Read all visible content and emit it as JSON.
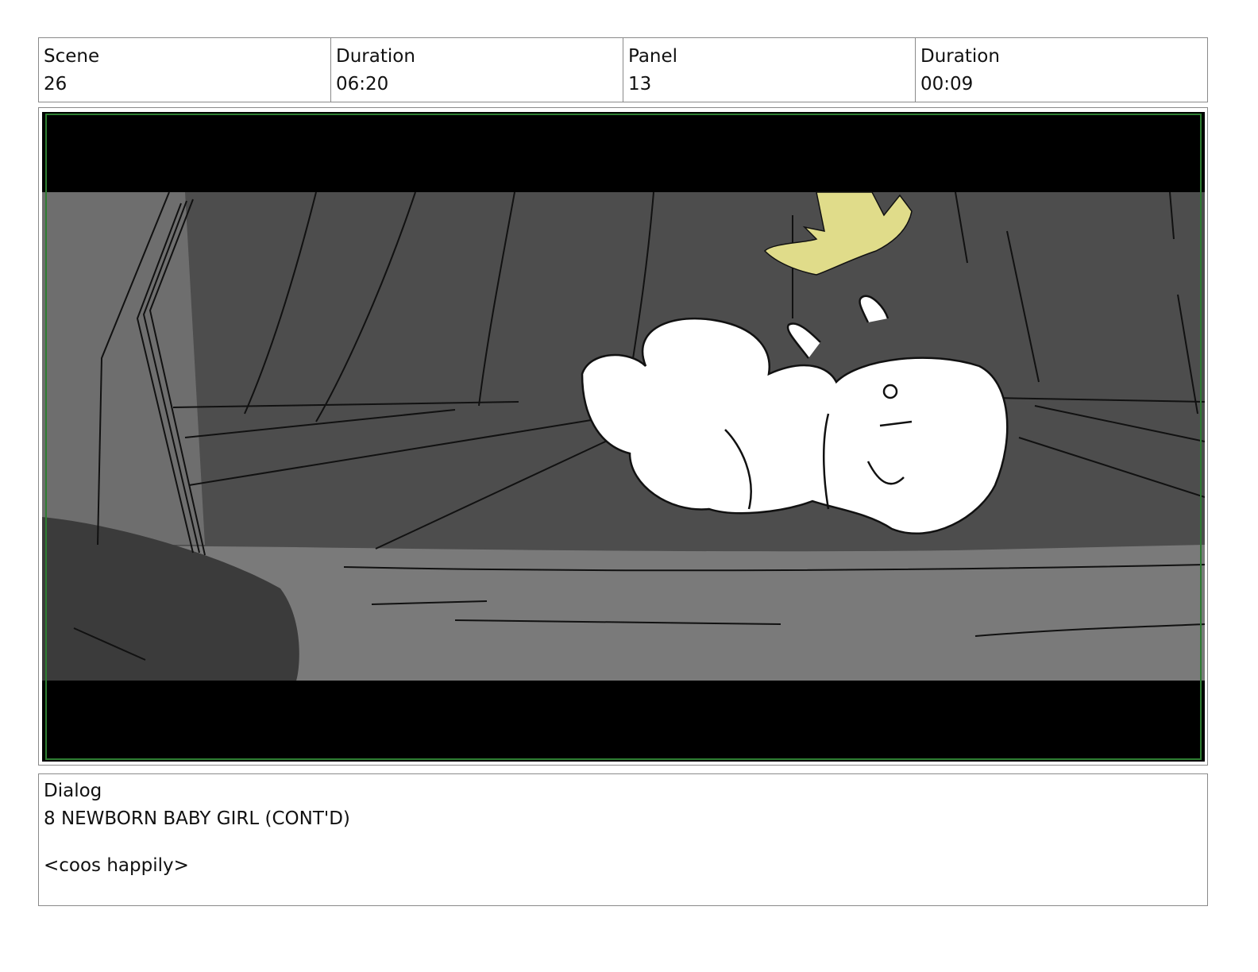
{
  "header": {
    "scene_label": "Scene",
    "scene_value": "26",
    "scene_duration_label": "Duration",
    "scene_duration_value": "06:20",
    "panel_label": "Panel",
    "panel_value": "13",
    "panel_duration_label": "Duration",
    "panel_duration_value": "00:09"
  },
  "colors": {
    "border": "#8a8a8a",
    "letterbox": "#000000",
    "safe_area_guide": "#2e7d32",
    "wall": "#4d4d4d",
    "floor": "#7a7a7a",
    "crown": "#e0dc8a"
  },
  "artwork": {
    "subject_icons": [
      "baby-icon",
      "crown-icon"
    ]
  },
  "dialog": {
    "label": "Dialog",
    "character": "8 NEWBORN BABY GIRL (CONT'D)",
    "line": "<coos happily>"
  }
}
